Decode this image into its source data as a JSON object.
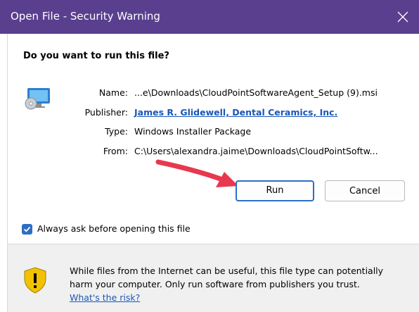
{
  "window": {
    "title": "Open File - Security Warning",
    "close_icon": "close-icon",
    "titlebar_color": "#5a3f8f"
  },
  "dialog": {
    "question": "Do you want to run this file?",
    "file_icon": "installer-disc-icon",
    "fields": {
      "name_label": "Name:",
      "name_value": "...e\\Downloads\\CloudPointSoftwareAgent_Setup (9).msi",
      "publisher_label": "Publisher:",
      "publisher_value": "James R. Glidewell, Dental Ceramics, Inc.",
      "type_label": "Type:",
      "type_value": "Windows Installer Package",
      "from_label": "From:",
      "from_value": "C:\\Users\\alexandra.jaime\\Downloads\\CloudPointSoftw..."
    },
    "run_button": "Run",
    "cancel_button": "Cancel",
    "annotation_arrow_color": "#e8384f",
    "checkbox": {
      "label": "Always ask before opening this file",
      "checked": true
    }
  },
  "footer": {
    "icon": "shield-warning-icon",
    "warning_text": "While files from the Internet can be useful, this file type can potentially harm your computer. Only run software from publishers you trust.",
    "risk_link": "What's the risk?"
  }
}
